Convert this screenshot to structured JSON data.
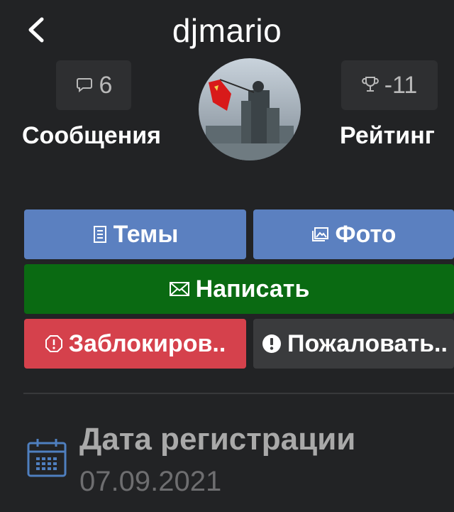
{
  "header": {
    "title": "djmario"
  },
  "stats": {
    "messages": {
      "value": "6",
      "label": "Сообщения"
    },
    "rating": {
      "value": "-11",
      "label": "Рейтинг"
    }
  },
  "buttons": {
    "topics": "Темы",
    "photo": "Фото",
    "write": "Написать",
    "block": "Заблокиров..",
    "report": "Пожаловать.."
  },
  "info": {
    "registration_label": "Дата регистрации",
    "registration_date": "07.09.2021"
  },
  "icons": [
    "back-icon",
    "message-icon",
    "trophy-icon",
    "document-icon",
    "image-icon",
    "envelope-icon",
    "block-icon",
    "alert-icon",
    "calendar-icon"
  ],
  "colors": {
    "background": "#222325",
    "accent_blue": "#5b80c0",
    "accent_green": "#0a6a12",
    "accent_red": "#d5414c",
    "neutral_button": "#3a3b3d"
  }
}
